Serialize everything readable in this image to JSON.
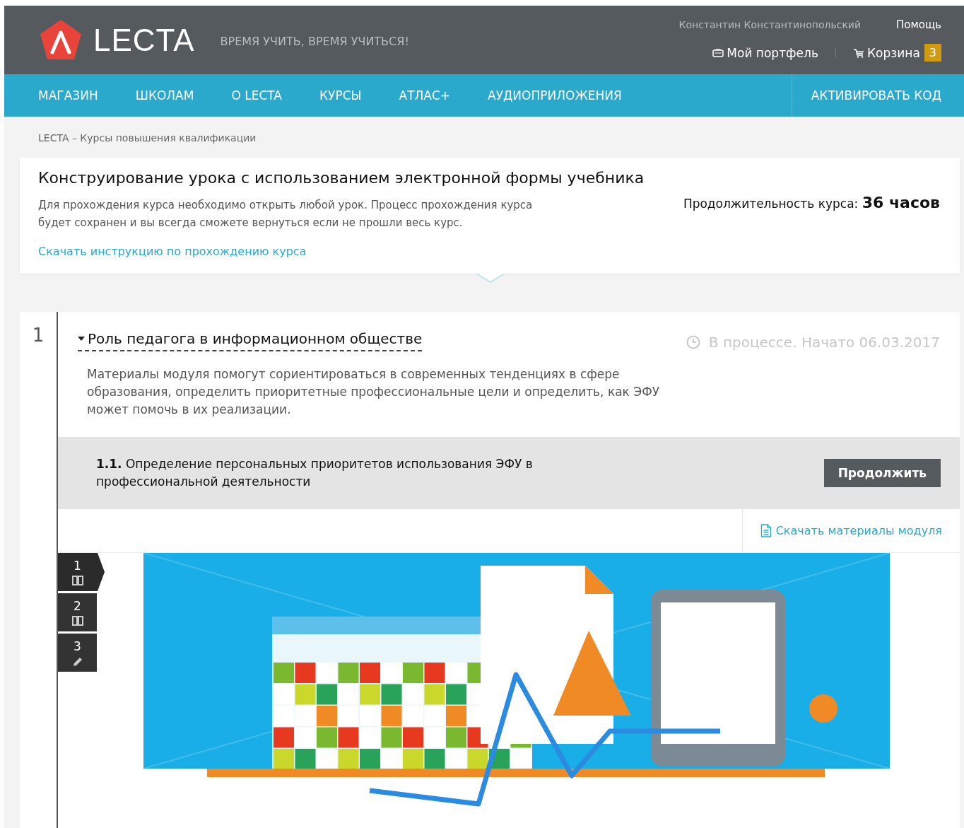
{
  "header": {
    "logo": "LECTA",
    "slogan": "ВРЕМЯ УЧИТЬ, ВРЕМЯ УЧИТЬСЯ!",
    "user": "Константин Константинопольский",
    "help": "Помощь",
    "portfolio": "Мой портфель",
    "cart": "Корзина",
    "cart_count": "3"
  },
  "nav": {
    "items": [
      {
        "label": "МАГАЗИН"
      },
      {
        "label": "ШКОЛАМ"
      },
      {
        "label": "О LECTA"
      },
      {
        "label": "КУРСЫ"
      },
      {
        "label": "АТЛАС+"
      },
      {
        "label": "АУДИОПРИЛОЖЕНИЯ"
      }
    ],
    "action": "АКТИВИРОВАТЬ КОД"
  },
  "breadcrumb": "LECTA – Курсы повышения квалификации",
  "course": {
    "title": "Конструирование урока с использованием электронной формы учебника",
    "description": "Для прохождения курса необходимо открыть любой урок. Процесс прохождения курса будет сохранен и вы всегда сможете вернуться если не прошли весь курс.",
    "duration_label": "Продолжительность курса:",
    "duration_value": "36 часов",
    "instructions_link": "Скачать инструкцию по прохождению курса"
  },
  "module": {
    "number": "1",
    "title": "Роль педагога в информационном обществе",
    "expanded": true,
    "status": "В процессе. Начато 06.03.2017",
    "description": "Материалы модуля помогут сориентироваться в современных тенденциях в сфере образования, определить приоритетные профессиональные цели и определить, как ЭФУ может помочь в их реализации.",
    "lesson": {
      "number": "1.1.",
      "title": "Определение персональных приоритетов использования ЭФУ в профессиональной деятельности",
      "button": "Продолжить"
    },
    "materials_link": "Скачать материалы модуля",
    "steps": [
      {
        "number": "1",
        "kind": "book",
        "selected": true
      },
      {
        "number": "2",
        "kind": "book",
        "selected": false
      },
      {
        "number": "3",
        "kind": "task",
        "selected": false
      }
    ]
  }
}
